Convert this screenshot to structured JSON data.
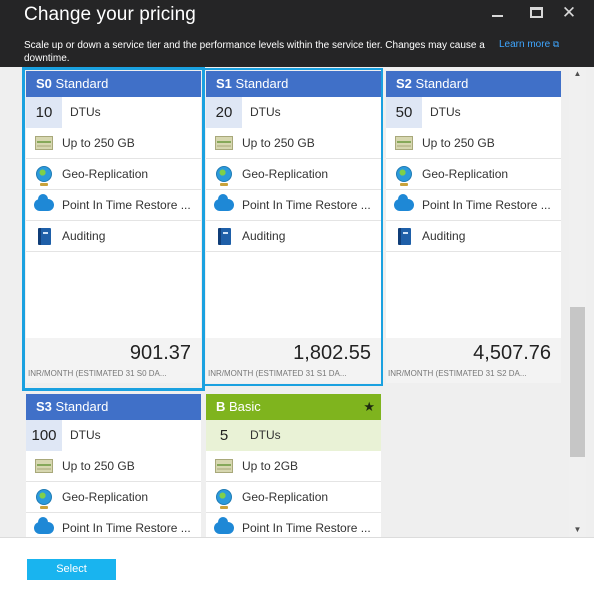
{
  "header": {
    "title": "Change your pricing",
    "description": "Scale up or down a service tier and the performance levels within the service tier. Changes may cause a downtime.",
    "learn_more": "Learn more",
    "minimize_icon": "minimize-icon",
    "maximize_icon": "maximize-icon",
    "close_icon": "close-icon"
  },
  "tiers": [
    {
      "code": "S0",
      "name": "Standard",
      "dtus": "10",
      "dtu_label": "DTUs",
      "features": [
        "Up to 250 GB",
        "Geo-Replication",
        "Point In Time Restore ...",
        "Auditing"
      ],
      "price": "901.37",
      "price_note": "INR/MONTH (ESTIMATED 31 S0 DA...",
      "selected": true
    },
    {
      "code": "S1",
      "name": "Standard",
      "dtus": "20",
      "dtu_label": "DTUs",
      "features": [
        "Up to 250 GB",
        "Geo-Replication",
        "Point In Time Restore ...",
        "Auditing"
      ],
      "price": "1,802.55",
      "price_note": "INR/MONTH (ESTIMATED 31 S1 DA...",
      "selected": false
    },
    {
      "code": "S2",
      "name": "Standard",
      "dtus": "50",
      "dtu_label": "DTUs",
      "features": [
        "Up to 250 GB",
        "Geo-Replication",
        "Point In Time Restore ...",
        "Auditing"
      ],
      "price": "4,507.76",
      "price_note": "INR/MONTH (ESTIMATED 31 S2 DA...",
      "selected": false
    },
    {
      "code": "S3",
      "name": "Standard",
      "dtus": "100",
      "dtu_label": "DTUs",
      "features": [
        "Up to 250 GB",
        "Geo-Replication",
        "Point In Time Restore ..."
      ],
      "selected": false
    },
    {
      "code": "B",
      "name": "Basic",
      "dtus": "5",
      "dtu_label": "DTUs",
      "features": [
        "Up to 2GB",
        "Geo-Replication",
        "Point In Time Restore ..."
      ],
      "recommended_icon": "star-icon",
      "selected": false
    }
  ],
  "feature_icons": [
    "storage-icon",
    "globe-icon",
    "cloud-icon",
    "book-icon"
  ],
  "colors": {
    "header_bg": "#252526",
    "standard_header": "#4070c8",
    "basic_header": "#7fb41e",
    "selection_border": "#1aa1e0",
    "select_button": "#19b4ef",
    "link": "#3fa6ff"
  },
  "footer": {
    "select_label": "Select"
  }
}
